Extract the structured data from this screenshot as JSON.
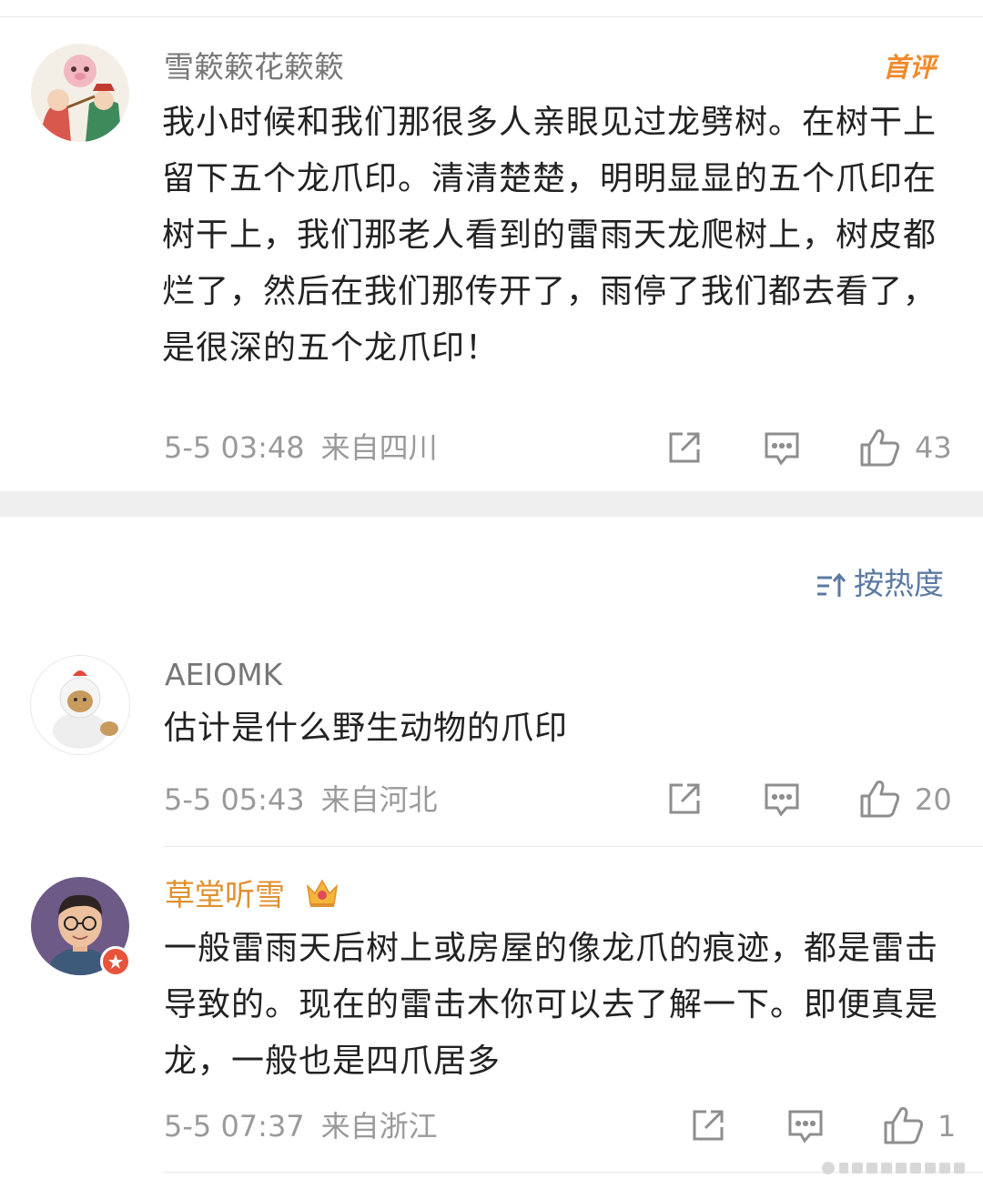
{
  "comments_top": [
    {
      "username": "雪簌簌花簌簌",
      "badge": "首评",
      "text": "我小时候和我们那很多人亲眼见过龙劈树。在树干上留下五个龙爪印。清清楚楚，明明显显的五个爪印在树干上，我们那老人看到的雷雨天龙爬树上，树皮都烂了，然后在我们那传开了，雨停了我们都去看了，是很深的五个龙爪印！",
      "time": "5-5 03:48",
      "source": "来自四川",
      "likes": "43",
      "icons": [
        "share-icon",
        "comment-icon",
        "like-icon"
      ]
    }
  ],
  "sort": {
    "label": "按热度",
    "icon": "sort-icon"
  },
  "comments": [
    {
      "username": "AEIOMK",
      "text": "估计是什么野生动物的爪印",
      "time": "5-5 05:43",
      "source": "来自河北",
      "likes": "20"
    },
    {
      "username": "草堂听雪",
      "crown": "crown-icon",
      "text": "一般雷雨天后树上或房屋的像龙爪的痕迹，都是雷击导致的。现在的雷击木你可以去了解一下。即便真是龙，一般也是四爪居多",
      "time": "5-5 07:37",
      "source": "来自浙江",
      "likes": "1"
    }
  ],
  "colors": {
    "username": "#777777",
    "vip_username": "#e0902e",
    "meta": "#9a9a9a",
    "sort_link": "#5b7aa3",
    "badge": "#f08a2a",
    "separator": "#efefef"
  }
}
